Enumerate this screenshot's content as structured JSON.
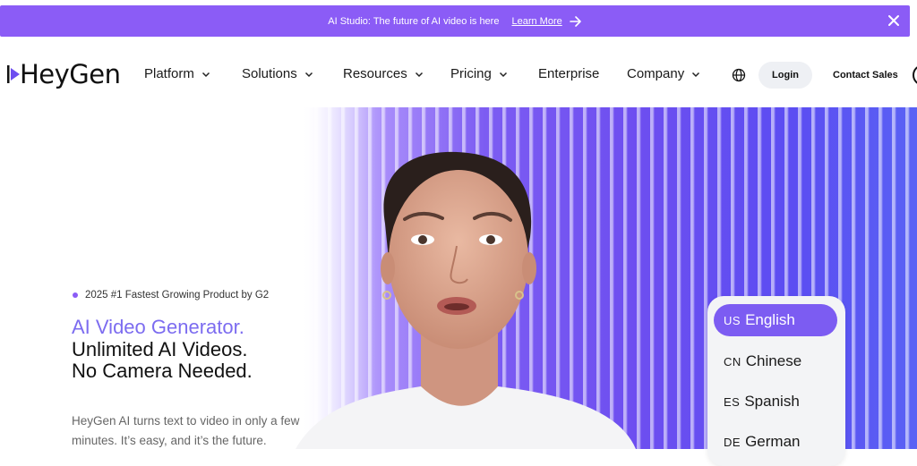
{
  "announcement": {
    "message": "AI Studio: The future of AI video is here",
    "link_label": "Learn More",
    "accent": "#8b5cf6"
  },
  "nav": {
    "logo": "HeyGen",
    "items": [
      {
        "label": "Platform",
        "has_dropdown": true
      },
      {
        "label": "Solutions",
        "has_dropdown": true
      },
      {
        "label": "Resources",
        "has_dropdown": true
      },
      {
        "label": "Pricing",
        "has_dropdown": true
      },
      {
        "label": "Enterprise",
        "has_dropdown": false
      },
      {
        "label": "Company",
        "has_dropdown": true
      }
    ],
    "login_label": "Login",
    "contact_label": "Contact Sales"
  },
  "hero": {
    "badge": "2025 #1 Fastest Growing Product by G2",
    "headline_accent": "AI Video Generator.",
    "headline_line2": "Unlimited AI Videos.",
    "headline_line3": "No Camera Needed.",
    "description": "HeyGen AI turns text to video in only a few minutes. It’s easy, and it’s the future."
  },
  "languages": [
    {
      "code": "US",
      "name": "English",
      "selected": true
    },
    {
      "code": "CN",
      "name": "Chinese",
      "selected": false
    },
    {
      "code": "ES",
      "name": "Spanish",
      "selected": false
    },
    {
      "code": "DE",
      "name": "German",
      "selected": false
    }
  ],
  "icons": {
    "announce_arrow": "arrow-right-icon",
    "announce_close": "close-icon",
    "menu_chevron": "chevron-down-icon",
    "language": "globe-icon"
  }
}
